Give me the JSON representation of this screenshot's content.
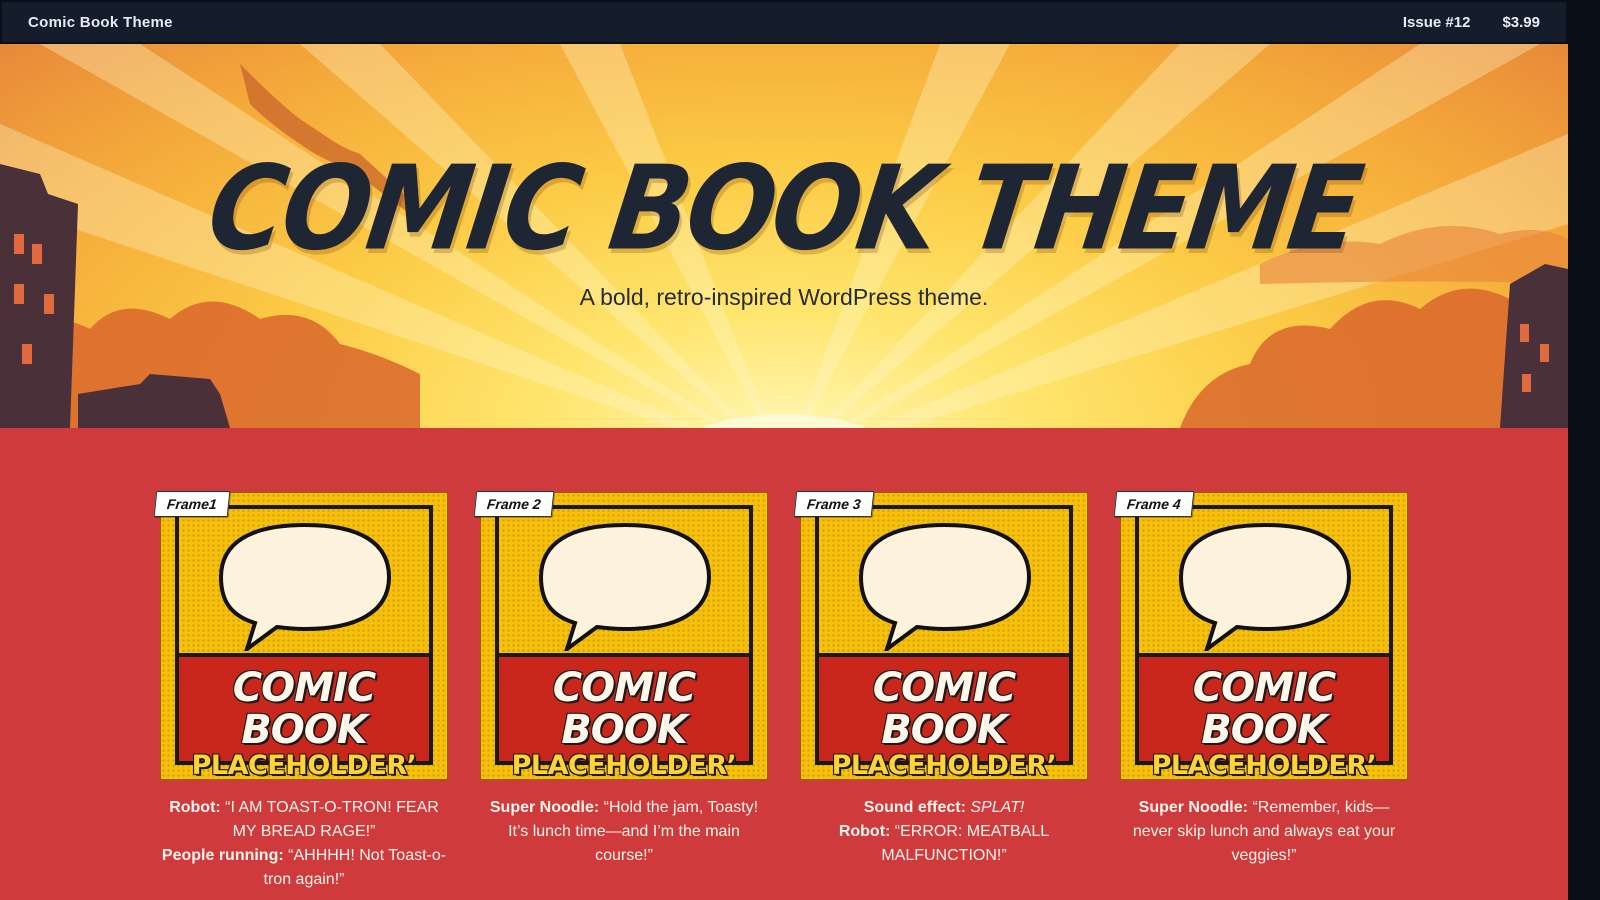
{
  "topbar": {
    "site_title": "Comic Book Theme",
    "issue": "Issue #12",
    "price": "$3.99"
  },
  "hero": {
    "title": "COMIC BOOK THEME",
    "subtitle": "A bold, retro-inspired WordPress theme."
  },
  "panel_art": {
    "line1": "COMIC BOOK",
    "line2": "PLACEHOLDER’"
  },
  "panels": [
    {
      "label": "Frame1",
      "lines": [
        {
          "speaker": "Robot:",
          "text": " “I AM TOAST-O-TRON! FEAR MY BREAD RAGE!”"
        },
        {
          "speaker": "People running:",
          "text": " “AHHHH! Not Toast-o-tron again!”"
        }
      ]
    },
    {
      "label": "Frame 2",
      "lines": [
        {
          "speaker": "Super Noodle:",
          "text": " “Hold the jam, Toasty! It’s lunch time—and I’m the main course!”"
        }
      ]
    },
    {
      "label": "Frame 3",
      "lines": [
        {
          "speaker": "Sound effect:",
          "text": " SPLAT!"
        },
        {
          "speaker": "Robot:",
          "text": " “ERROR: MEATBALL MALFUNCTION!”"
        }
      ]
    },
    {
      "label": "Frame 4",
      "lines": [
        {
          "speaker": "Super Noodle:",
          "text": " “Remember, kids—never skip lunch and always eat your veggies!”"
        }
      ]
    }
  ],
  "colors": {
    "topbar": "#151c2b",
    "background": "#cf3a3c",
    "panel": "#f5c10c",
    "banner": "#c9261c",
    "title": "#1e2633"
  }
}
